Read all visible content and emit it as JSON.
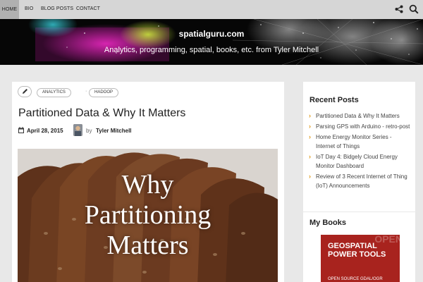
{
  "nav": {
    "items": [
      "HOME",
      "BIO",
      "BLOG POSTS",
      "CONTACT"
    ]
  },
  "header": {
    "site_title": "spatialguru.com",
    "tagline": "Analytics, programming, spatial, books, etc. from Tyler Mitchell"
  },
  "post": {
    "tags": [
      "ANALYTICS",
      "HADOOP"
    ],
    "title": "Partitioned Data & Why It Matters",
    "date": "April 28, 2015",
    "by": "by",
    "author": "Tyler Mitchell",
    "image_text": [
      "Why",
      "Partitioning",
      "Matters"
    ]
  },
  "sidebar": {
    "recent_title": "Recent Posts",
    "recent_posts": [
      "Partitioned Data & Why It Matters",
      "Parsing GPS with Arduino - retro-post",
      "Home Energy Monitor Series - Internet of Things",
      "IoT Day 4: Bidgely Cloud Energy Monitor Dashboard",
      "Review of 3 Recent Internet of Thing (IoT) Announcements"
    ],
    "books_title": "My Books",
    "book": {
      "title_line1": "GEOSPATIAL",
      "title_line2": "POWER TOOLS",
      "subtitle": "OPEN SOURCE GDAL/OGR",
      "watermark": "OPEN"
    }
  },
  "colors": {
    "accent": "#e09a18",
    "book": "#a8231e",
    "header_bg": "#060606"
  },
  "icons": {
    "share": "share-icon",
    "search": "search-icon",
    "edit": "pencil-icon",
    "calendar": "calendar-icon"
  }
}
